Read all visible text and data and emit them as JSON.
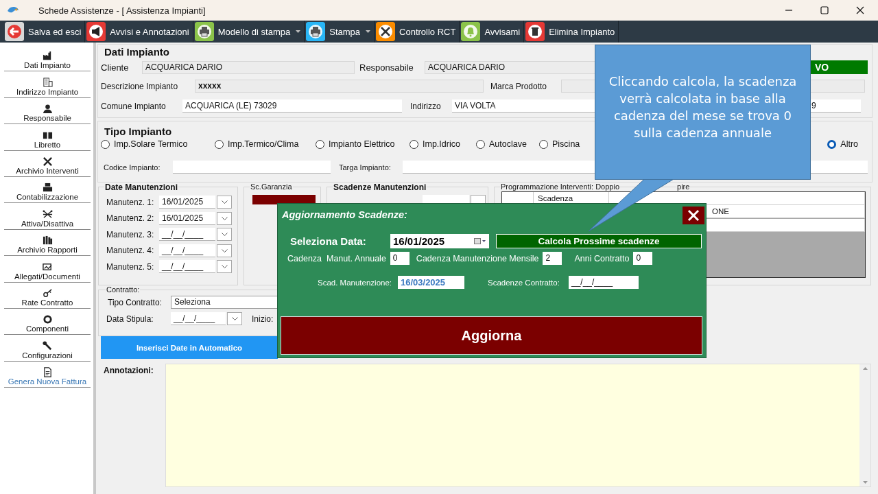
{
  "window": {
    "title": "Schede Assistenze - [ Assistenza Impianti]"
  },
  "toolbar": [
    {
      "label": "Salva ed esci",
      "color": "#d9d9d9",
      "dropdown": false
    },
    {
      "label": "Avvisi e Annotazioni",
      "color": "#e53935",
      "dropdown": false
    },
    {
      "label": "Modello di stampa",
      "color": "#8bc34a",
      "dropdown": true
    },
    {
      "label": "Stampa",
      "color": "#29b6f6",
      "dropdown": true
    },
    {
      "label": "Controllo RCT",
      "color": "#fb8c00",
      "dropdown": false
    },
    {
      "label": "Avvisami",
      "color": "#8bc34a",
      "dropdown": false
    },
    {
      "label": "Elimina Impianto",
      "color": "#e53935",
      "dropdown": false
    }
  ],
  "sidebar": [
    {
      "label": "Dati Impianto",
      "kind": "item"
    },
    {
      "label": "Indirizzo Impianto",
      "kind": "item"
    },
    {
      "label": "Responsabile",
      "kind": "item"
    },
    {
      "label": "Libretto",
      "kind": "item"
    },
    {
      "label": "Archivio Interventi",
      "kind": "item"
    },
    {
      "label": "Contabilizzazione",
      "kind": "item"
    },
    {
      "label": "Attiva/Disattiva",
      "kind": "item"
    },
    {
      "label": "Archivio Rapporti",
      "kind": "item"
    },
    {
      "label": "Allegati/Documenti",
      "kind": "item"
    },
    {
      "label": "Rate Contratto",
      "kind": "item"
    },
    {
      "label": "Componenti",
      "kind": "item"
    },
    {
      "label": "Configurazioni",
      "kind": "item"
    },
    {
      "label": "Genera Nuova Fattura",
      "kind": "link"
    }
  ],
  "dati_impianto": {
    "title": "Dati Impianto",
    "rows": [
      [
        {
          "kind": "field",
          "label": "Cliente",
          "value": "ACQUARICA DARIO"
        },
        {
          "kind": "field",
          "label": "Responsabile",
          "value": "ACQUARICA DARIO"
        },
        {
          "kind": "badge",
          "value": "VO"
        }
      ],
      [
        {
          "kind": "field",
          "label": "Descrizione Impianto",
          "value": "xxxxx"
        },
        {
          "kind": "field",
          "label": "Marca Prodotto"
        }
      ],
      [
        {
          "kind": "field",
          "label": "Comune Impianto",
          "value": "ACQUARICA (LE) 73029"
        },
        {
          "kind": "field",
          "label": "Indirizzo",
          "value": "VIA VOLTA"
        },
        {
          "kind": "field",
          "value": "9"
        }
      ]
    ]
  },
  "tipo_impianto": {
    "title": "Tipo Impianto",
    "options": [
      {
        "label": "Imp.Solare Termico",
        "selected": false
      },
      {
        "label": "Imp.Termico/Clima",
        "selected": false
      },
      {
        "label": "Impianto Elettrico",
        "selected": false
      },
      {
        "label": "Imp.Idrico",
        "selected": false
      },
      {
        "label": "Autoclave",
        "selected": false
      },
      {
        "label": "Piscina",
        "selected": false
      },
      {
        "label": "Altro",
        "selected": true
      }
    ],
    "codice_label": "Codice Impianto:",
    "targa_label": "Targa Impianto:"
  },
  "date_manutenzioni": {
    "title": "Date Manutenzioni",
    "rows": [
      {
        "label": "Manutenz. 1:",
        "value": "16/01/2025"
      },
      {
        "label": "Manutenz. 2:",
        "value": "16/01/2025"
      },
      {
        "label": "Manutenz. 3:",
        "value": "__/__/____"
      },
      {
        "label": "Manutenz. 4:",
        "value": "__/__/____"
      },
      {
        "label": "Manutenz. 5:",
        "value": "__/__/____"
      }
    ]
  },
  "garanzia": {
    "title": "Sc.Garanzia"
  },
  "scadenze_manutenzioni": {
    "title": "Scadenze Manutenzioni"
  },
  "programmazione": {
    "title": "Programmazione Interventi: Doppio",
    "title_tail": "pire",
    "header": "Scadenza",
    "cell": "ONE"
  },
  "contratto": {
    "title": "Contratto:",
    "tipo_label": "Tipo Contratto:",
    "tipo_value": "Seleziona",
    "stipula_label": "Data Stipula:",
    "stipula_value": "__/__/____",
    "inizio_label": "Inizio:"
  },
  "auto_button": "Inserisci Date in Automatico",
  "annotazioni": {
    "label": "Annotazioni:"
  },
  "dialog": {
    "title": "Aggiornamento Scadenze:",
    "date_label": "Seleziona Data:",
    "date_value": "16/01/2025",
    "calc_button": "Calcola Prossime scadenze",
    "cadenze": [
      {
        "label": "Cadenza  Manut. Annuale",
        "value": "0"
      },
      {
        "label": "Cadenza Manutenzione Mensile",
        "value": "2"
      },
      {
        "label": "Anni Contratto",
        "value": "0"
      }
    ],
    "scad_label": "Scad. Manutenzione:",
    "scad_value": "16/03/2025",
    "contratto_label": "Scadenze Contratto:",
    "contratto_value": "__/__/____",
    "update_button": "Aggiorna"
  },
  "callout": {
    "text": "Cliccando calcola, la scadenza verrà calcolata in base alla cadenza del mese se trova 0 sulla cadenza annuale"
  }
}
